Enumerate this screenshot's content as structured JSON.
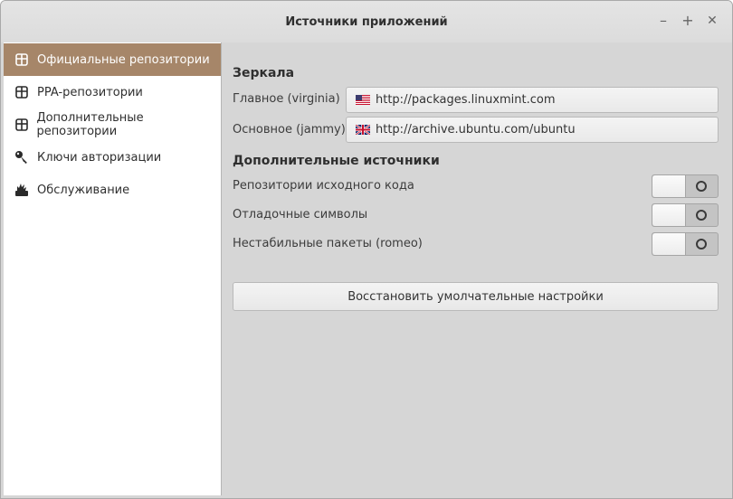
{
  "window": {
    "title": "Источники приложений",
    "controls": [
      "minimize-icon",
      "maximize-icon",
      "close-icon"
    ]
  },
  "sidebar": {
    "active_index": 0,
    "items": [
      {
        "label": "Официальные репозитории",
        "icon": "package-icon"
      },
      {
        "label": "PPA-репозитории",
        "icon": "package-icon"
      },
      {
        "label": "Дополнительные репозитории",
        "icon": "package-icon"
      },
      {
        "label": "Ключи авторизации",
        "icon": "key-icon"
      },
      {
        "label": "Обслуживание",
        "icon": "maintenance-icon"
      }
    ]
  },
  "mirrors": {
    "heading": "Зеркала",
    "main": {
      "label": "Главное (virginia)",
      "url": "http://packages.linuxmint.com",
      "flag": "us-flag-icon"
    },
    "base": {
      "label": "Основное (jammy)",
      "url": "http://archive.ubuntu.com/ubuntu",
      "flag": "uk-flag-icon"
    }
  },
  "optional_sources": {
    "heading": "Дополнительные источники",
    "items": [
      {
        "label": "Репозитории исходного кода",
        "enabled": false
      },
      {
        "label": "Отладочные символы",
        "enabled": false
      },
      {
        "label": "Нестабильные пакеты (romeo)",
        "enabled": false
      }
    ]
  },
  "restore_button": {
    "label": "Восстановить умолчательные настройки"
  },
  "colors": {
    "accent": "#a68669",
    "window_bg": "#d6d6d6",
    "sidebar_bg": "#ffffff"
  }
}
